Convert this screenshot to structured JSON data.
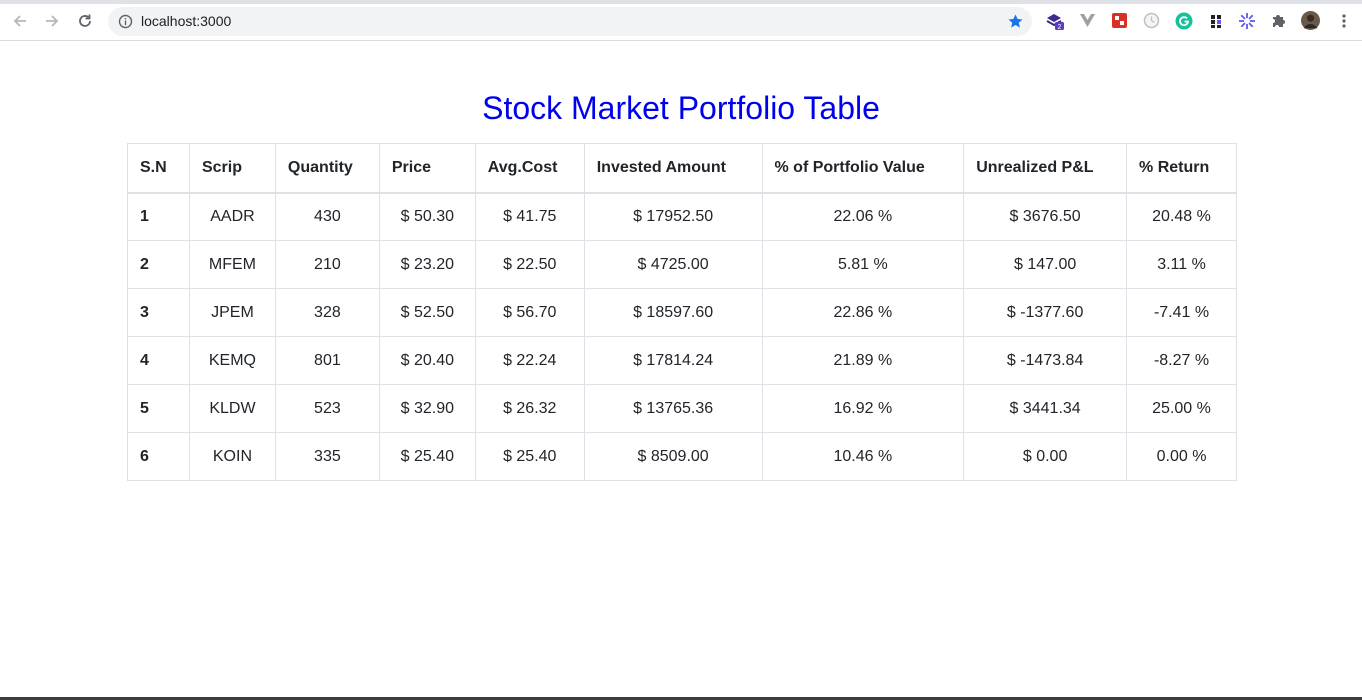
{
  "browser": {
    "url": "localhost:3000",
    "extension_badge": "2"
  },
  "page": {
    "title": "Stock Market Portfolio Table"
  },
  "table": {
    "columns": [
      "S.N",
      "Scrip",
      "Quantity",
      "Price",
      "Avg.Cost",
      "Invested Amount",
      "% of Portfolio Value",
      "Unrealized P&L",
      "% Return"
    ],
    "rows": [
      [
        "1",
        "AADR",
        "430",
        "$ 50.30",
        "$ 41.75",
        "$ 17952.50",
        "22.06 %",
        "$ 3676.50",
        "20.48 %"
      ],
      [
        "2",
        "MFEM",
        "210",
        "$ 23.20",
        "$ 22.50",
        "$ 4725.00",
        "5.81 %",
        "$ 147.00",
        "3.11 %"
      ],
      [
        "3",
        "JPEM",
        "328",
        "$ 52.50",
        "$ 56.70",
        "$ 18597.60",
        "22.86 %",
        "$ -1377.60",
        "-7.41 %"
      ],
      [
        "4",
        "KEMQ",
        "801",
        "$ 20.40",
        "$ 22.24",
        "$ 17814.24",
        "21.89 %",
        "$ -1473.84",
        "-8.27 %"
      ],
      [
        "5",
        "KLDW",
        "523",
        "$ 32.90",
        "$ 26.32",
        "$ 13765.36",
        "16.92 %",
        "$ 3441.34",
        "25.00 %"
      ],
      [
        "6",
        "KOIN",
        "335",
        "$ 25.40",
        "$ 25.40",
        "$ 8509.00",
        "10.46 %",
        "$ 0.00",
        "0.00 %"
      ]
    ]
  },
  "colors": {
    "title": "#0000ee",
    "star": "#1a73e8",
    "grammarly": "#15c39a"
  }
}
